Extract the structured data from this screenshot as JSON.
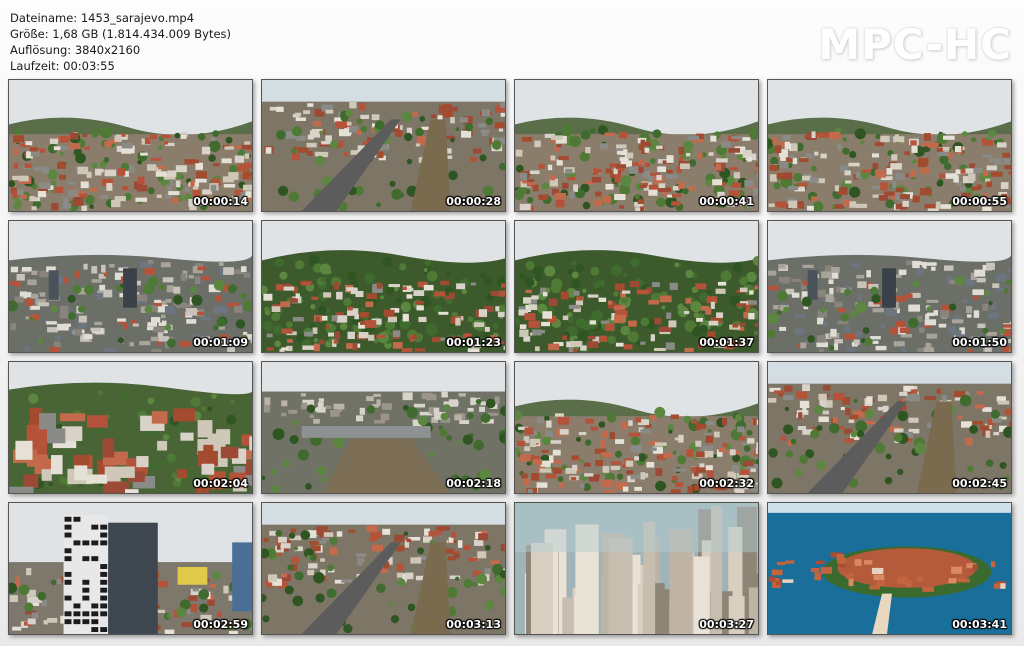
{
  "file_info": {
    "filename": "Dateiname: 1453_sarajevo.mp4",
    "size": "Größe: 1,68 GB (1.814.434.009 Bytes)",
    "resolution": "Auflösung: 3840x2160",
    "duration": "Laufzeit: 00:03:55"
  },
  "logo": "MPC-HC",
  "thumbnails": [
    {
      "timestamp": "00:00:14",
      "scene": "hills-city"
    },
    {
      "timestamp": "00:00:28",
      "scene": "river-road"
    },
    {
      "timestamp": "00:00:41",
      "scene": "city-valley"
    },
    {
      "timestamp": "00:00:55",
      "scene": "city-dense"
    },
    {
      "timestamp": "00:01:09",
      "scene": "modern-city"
    },
    {
      "timestamp": "00:01:23",
      "scene": "hills-houses"
    },
    {
      "timestamp": "00:01:37",
      "scene": "hills-houses"
    },
    {
      "timestamp": "00:01:50",
      "scene": "modern-city"
    },
    {
      "timestamp": "00:02:04",
      "scene": "houses-close"
    },
    {
      "timestamp": "00:02:18",
      "scene": "river-bridge"
    },
    {
      "timestamp": "00:02:32",
      "scene": "hills-city"
    },
    {
      "timestamp": "00:02:45",
      "scene": "river-road"
    },
    {
      "timestamp": "00:02:59",
      "scene": "tower"
    },
    {
      "timestamp": "00:03:13",
      "scene": "river-road"
    },
    {
      "timestamp": "00:03:27",
      "scene": "skyscrapers"
    },
    {
      "timestamp": "00:03:41",
      "scene": "island"
    }
  ]
}
